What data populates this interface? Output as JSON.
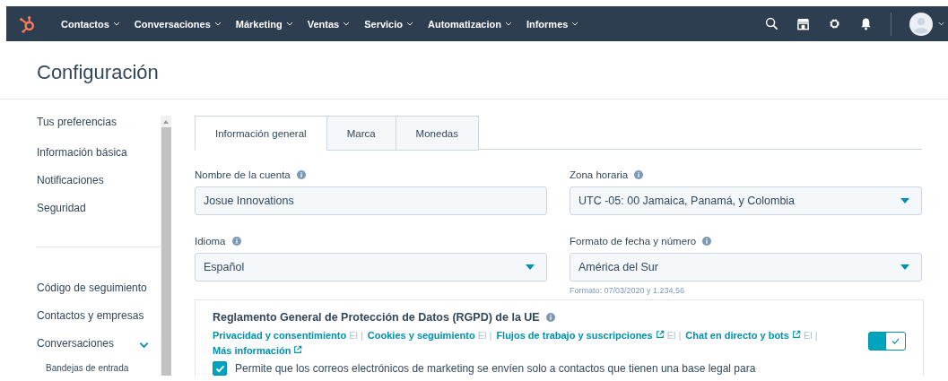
{
  "nav": {
    "items": [
      {
        "label": "Contactos"
      },
      {
        "label": "Conversaciones"
      },
      {
        "label": "Márketing"
      },
      {
        "label": "Ventas"
      },
      {
        "label": "Servicio"
      },
      {
        "label": "Automatizacion"
      },
      {
        "label": "Informes"
      }
    ]
  },
  "page_title": "Configuración",
  "sidebar": {
    "heading": "Tus preferencias",
    "items": [
      {
        "label": "Información básica"
      },
      {
        "label": "Notificaciones"
      },
      {
        "label": "Seguridad"
      }
    ],
    "account_items": [
      {
        "label": "Código de seguimiento",
        "expanded": false
      },
      {
        "label": "Contactos y empresas",
        "expanded": false
      },
      {
        "label": "Conversaciones",
        "expanded": true,
        "children": [
          {
            "label": "Bandejas de entrada"
          }
        ]
      }
    ]
  },
  "tabs": [
    {
      "label": "Información general",
      "selected": true
    },
    {
      "label": "Marca",
      "selected": false
    },
    {
      "label": "Monedas",
      "selected": false
    }
  ],
  "fields": [
    {
      "kind": "text",
      "label": "Nombre de la cuenta",
      "value": "Josue Innovations"
    },
    {
      "kind": "select",
      "label": "Zona horaria",
      "value": "UTC -05: 00 Jamaica, Panamá, y Colombia"
    },
    {
      "kind": "select",
      "label": "Idioma",
      "value": "Español"
    },
    {
      "kind": "select",
      "label": "Formato de fecha y número",
      "value": "América del Sur",
      "hint": "Formato: 07/03/2020 y 1.234,56"
    }
  ],
  "gdpr": {
    "title": "Reglamento General de Protección de Datos (RGPD) de la UE",
    "links": [
      {
        "kind": "link",
        "label": "Privacidad y consentimiento",
        "external": false
      },
      {
        "kind": "separator",
        "label": "El |"
      },
      {
        "kind": "link",
        "label": "Cookies y seguimiento",
        "external": false
      },
      {
        "kind": "separator",
        "label": "El |"
      },
      {
        "kind": "link",
        "label": "Flujos de trabajo y suscripciones",
        "external": true
      },
      {
        "kind": "separator",
        "label": "El |"
      },
      {
        "kind": "link",
        "label": "Chat en directo y bots",
        "external": true
      },
      {
        "kind": "separator",
        "label": "El |"
      },
      {
        "kind": "link",
        "label": "Más información",
        "external": true
      }
    ],
    "on": true,
    "checkbox": {
      "checked": true,
      "label": "Permite que los correos electrónicos de marketing se envíen solo a contactos que tienen una base legal para"
    }
  }
}
